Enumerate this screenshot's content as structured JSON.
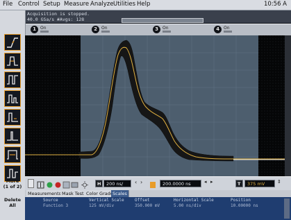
{
  "menubar": {
    "items": [
      "File",
      "Control",
      "Setup",
      "Measure",
      "Analyze",
      "Utilities",
      "Help"
    ],
    "clock": "10:56 A"
  },
  "status": {
    "line1": "Acquisition is stopped.",
    "line2": "40.0 GSa/s   #Avgs: 128"
  },
  "channels": [
    {
      "num": "1",
      "state": "On"
    },
    {
      "num": "2",
      "state": "On"
    },
    {
      "num": "3",
      "state": "On"
    },
    {
      "num": "4",
      "state": "On"
    }
  ],
  "colors": {
    "trace": "#e0b040",
    "envelope": "#161616",
    "grid_region": "#4d5e6e",
    "tab_active": "#3d5c8c",
    "info_panel": "#1f3d70",
    "tool_border": "#e89c2a"
  },
  "left_toolbar": {
    "tools": [
      "edge-trigger-icon",
      "pulse-width-icon",
      "pulse-icon",
      "runt-icon",
      "pulse-pair-icon",
      "glitch-icon",
      "pattern-icon",
      "state-icon"
    ],
    "more_label_1": "More",
    "more_label_2": "(1 of 2)",
    "delete_label_1": "Delete",
    "delete_label_2": "All"
  },
  "horizontal": {
    "scale_label": "H",
    "scale_value": "200 ns/",
    "position_value": "200.0000 ns",
    "trigger_label": "T",
    "trigger_value": "375 mV"
  },
  "tabs": [
    {
      "label": "Measurements",
      "active": false
    },
    {
      "label": "Mask Test",
      "active": false
    },
    {
      "label": "Color Grade",
      "active": false
    },
    {
      "label": "Scales",
      "active": true
    }
  ],
  "scales_table": {
    "headers": [
      "Source",
      "Vertical Scale",
      "Offset",
      "Horizontal Scale",
      "Position"
    ],
    "row": [
      "Function 3",
      "125 mV/div",
      "350.000 mV",
      "5.00 ns/div",
      "10.00000 ns"
    ]
  }
}
